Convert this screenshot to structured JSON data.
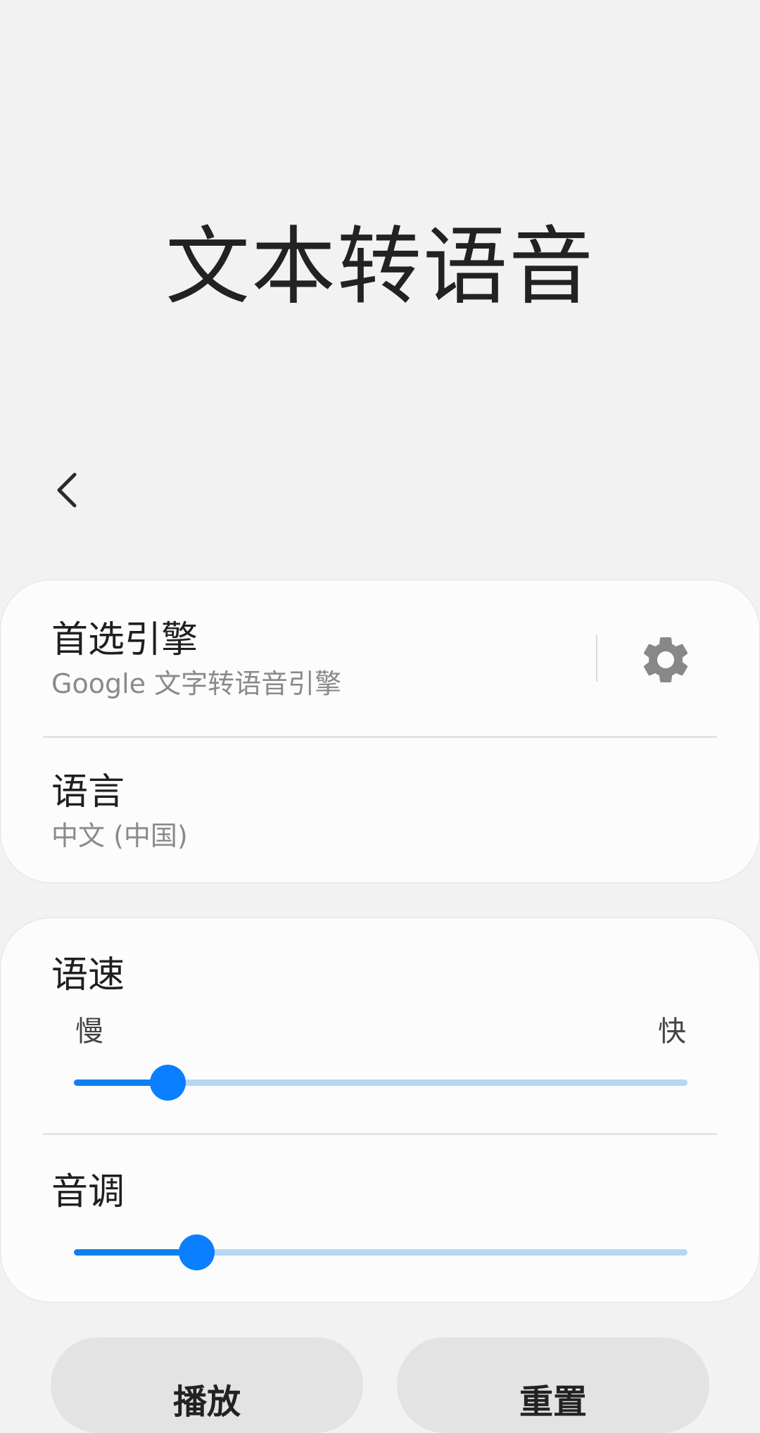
{
  "page": {
    "title": "文本转语音"
  },
  "icons": {
    "back": "chevron-left",
    "settings": "gear"
  },
  "engine": {
    "title": "首选引擎",
    "value": "Google 文字转语音引擎"
  },
  "language": {
    "title": "语言",
    "value": "中文 (中国)"
  },
  "speech_rate": {
    "title": "语速",
    "slow_label": "慢",
    "fast_label": "快",
    "level": 0.153
  },
  "pitch": {
    "title": "音调",
    "level": 0.2
  },
  "buttons": {
    "play": "播放",
    "reset": "重置"
  },
  "colors": {
    "accent": "#0a7fff",
    "track": "#b4d7f6",
    "background": "#f2f2f2",
    "card": "#fcfcfc",
    "button": "#e3e3e3"
  }
}
